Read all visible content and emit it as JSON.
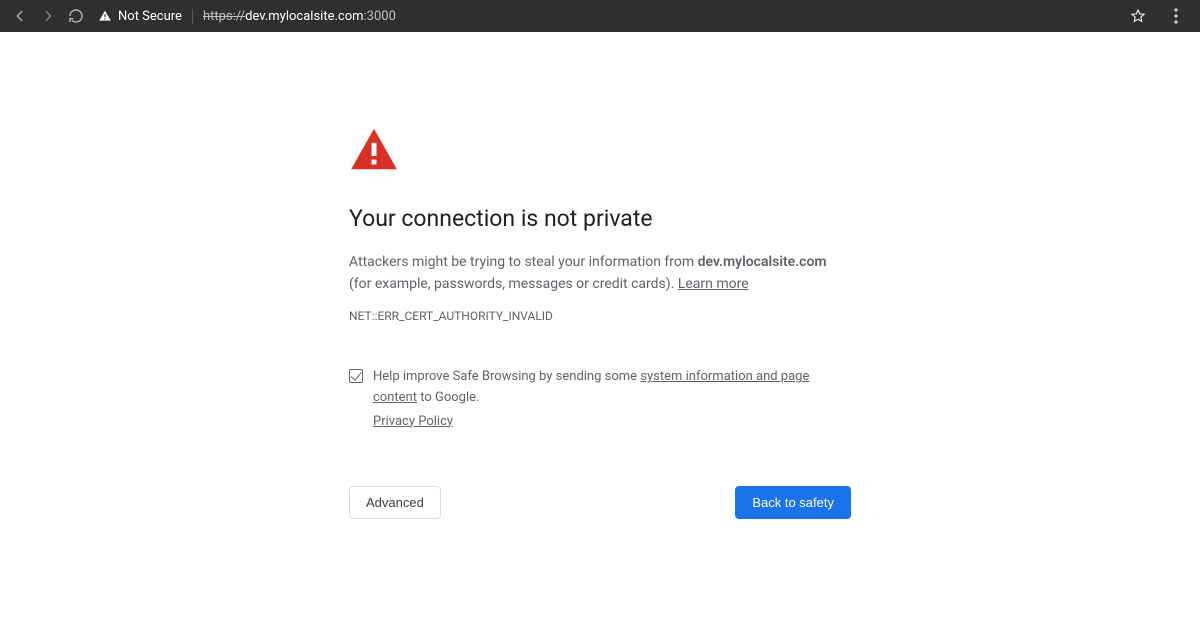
{
  "toolbar": {
    "not_secure_label": "Not Secure",
    "url_scheme": "https",
    "url_sep": "://",
    "url_host": "dev.mylocalsite.com",
    "url_port": ":3000"
  },
  "page": {
    "title": "Your connection is not private",
    "body_pre": "Attackers might be trying to steal your information from ",
    "body_host": "dev.mylocalsite.com",
    "body_post": " (for example, passwords, messages or credit cards). ",
    "learn_more": "Learn more",
    "error_code": "NET::ERR_CERT_AUTHORITY_INVALID",
    "optin_pre": "Help improve Safe Browsing by sending some ",
    "optin_link": "system information and page content",
    "optin_post": " to Google.",
    "privacy": "Privacy Policy",
    "advanced": "Advanced",
    "back": "Back to safety"
  }
}
